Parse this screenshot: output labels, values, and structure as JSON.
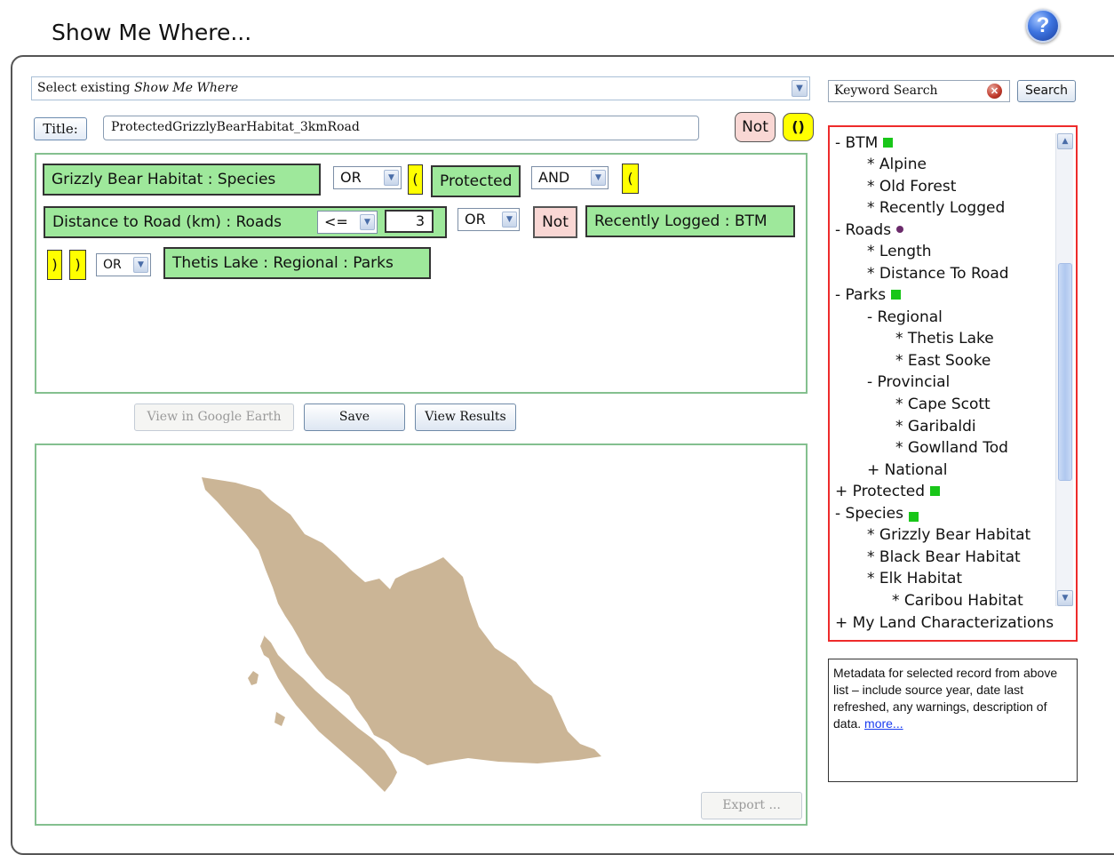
{
  "page": {
    "title": "Show Me Where...",
    "help_icon_glyph": "?"
  },
  "query": {
    "select_prefix": "Select existing ",
    "select_italic": "Show Me Where",
    "title_label": "Title:",
    "title_value": "ProtectedGrizzlyBearHabitat_3kmRoad",
    "not_label": "Not",
    "paren_label": "()"
  },
  "builder": {
    "term_1": "Grizzly Bear Habitat : Species",
    "op_1": "OR",
    "open_paren_1": "(",
    "term_2": "Protected",
    "op_2": "AND",
    "open_paren_2": "(",
    "term_3": "Distance to Road (km) : Roads",
    "comparator": "<=",
    "number_value": "3",
    "op_3": "OR",
    "not_label": "Not",
    "term_4": "Recently Logged : BTM",
    "close_paren_1": ")",
    "close_paren_2": ")",
    "op_4": "OR",
    "term_5": "Thetis Lake : Regional : Parks"
  },
  "actions": {
    "google_earth": "View in Google Earth",
    "save": "Save",
    "view_results": "View Results",
    "export": "Export ..."
  },
  "search": {
    "placeholder": "Keyword Search",
    "button": "Search"
  },
  "tree": {
    "items": [
      "- BTM",
      "* Alpine",
      "* Old Forest",
      "* Recently Logged",
      "- Roads",
      "* Length",
      "* Distance To Road",
      "- Parks",
      "- Regional",
      "* Thetis Lake",
      "* East Sooke",
      "- Provincial",
      "* Cape Scott",
      "* Garibaldi",
      "* Gowlland Tod",
      "+ National",
      "+ Protected",
      "- Species",
      "* Grizzly Bear Habitat",
      "* Black Bear Habitat",
      "* Elk Habitat",
      "* Caribou Habitat",
      "+ My Land Characterizations"
    ]
  },
  "metadata": {
    "text": "Metadata for selected record from above list – include source year, date last refreshed, any warnings, description of data. ",
    "link": "more..."
  },
  "colors": {
    "term_green": "#9ee89b",
    "paren_yellow": "#ffff00",
    "not_pink": "#f9d7d4",
    "tree_border_red": "#ee2b2b",
    "map_land": "#cbb596"
  }
}
